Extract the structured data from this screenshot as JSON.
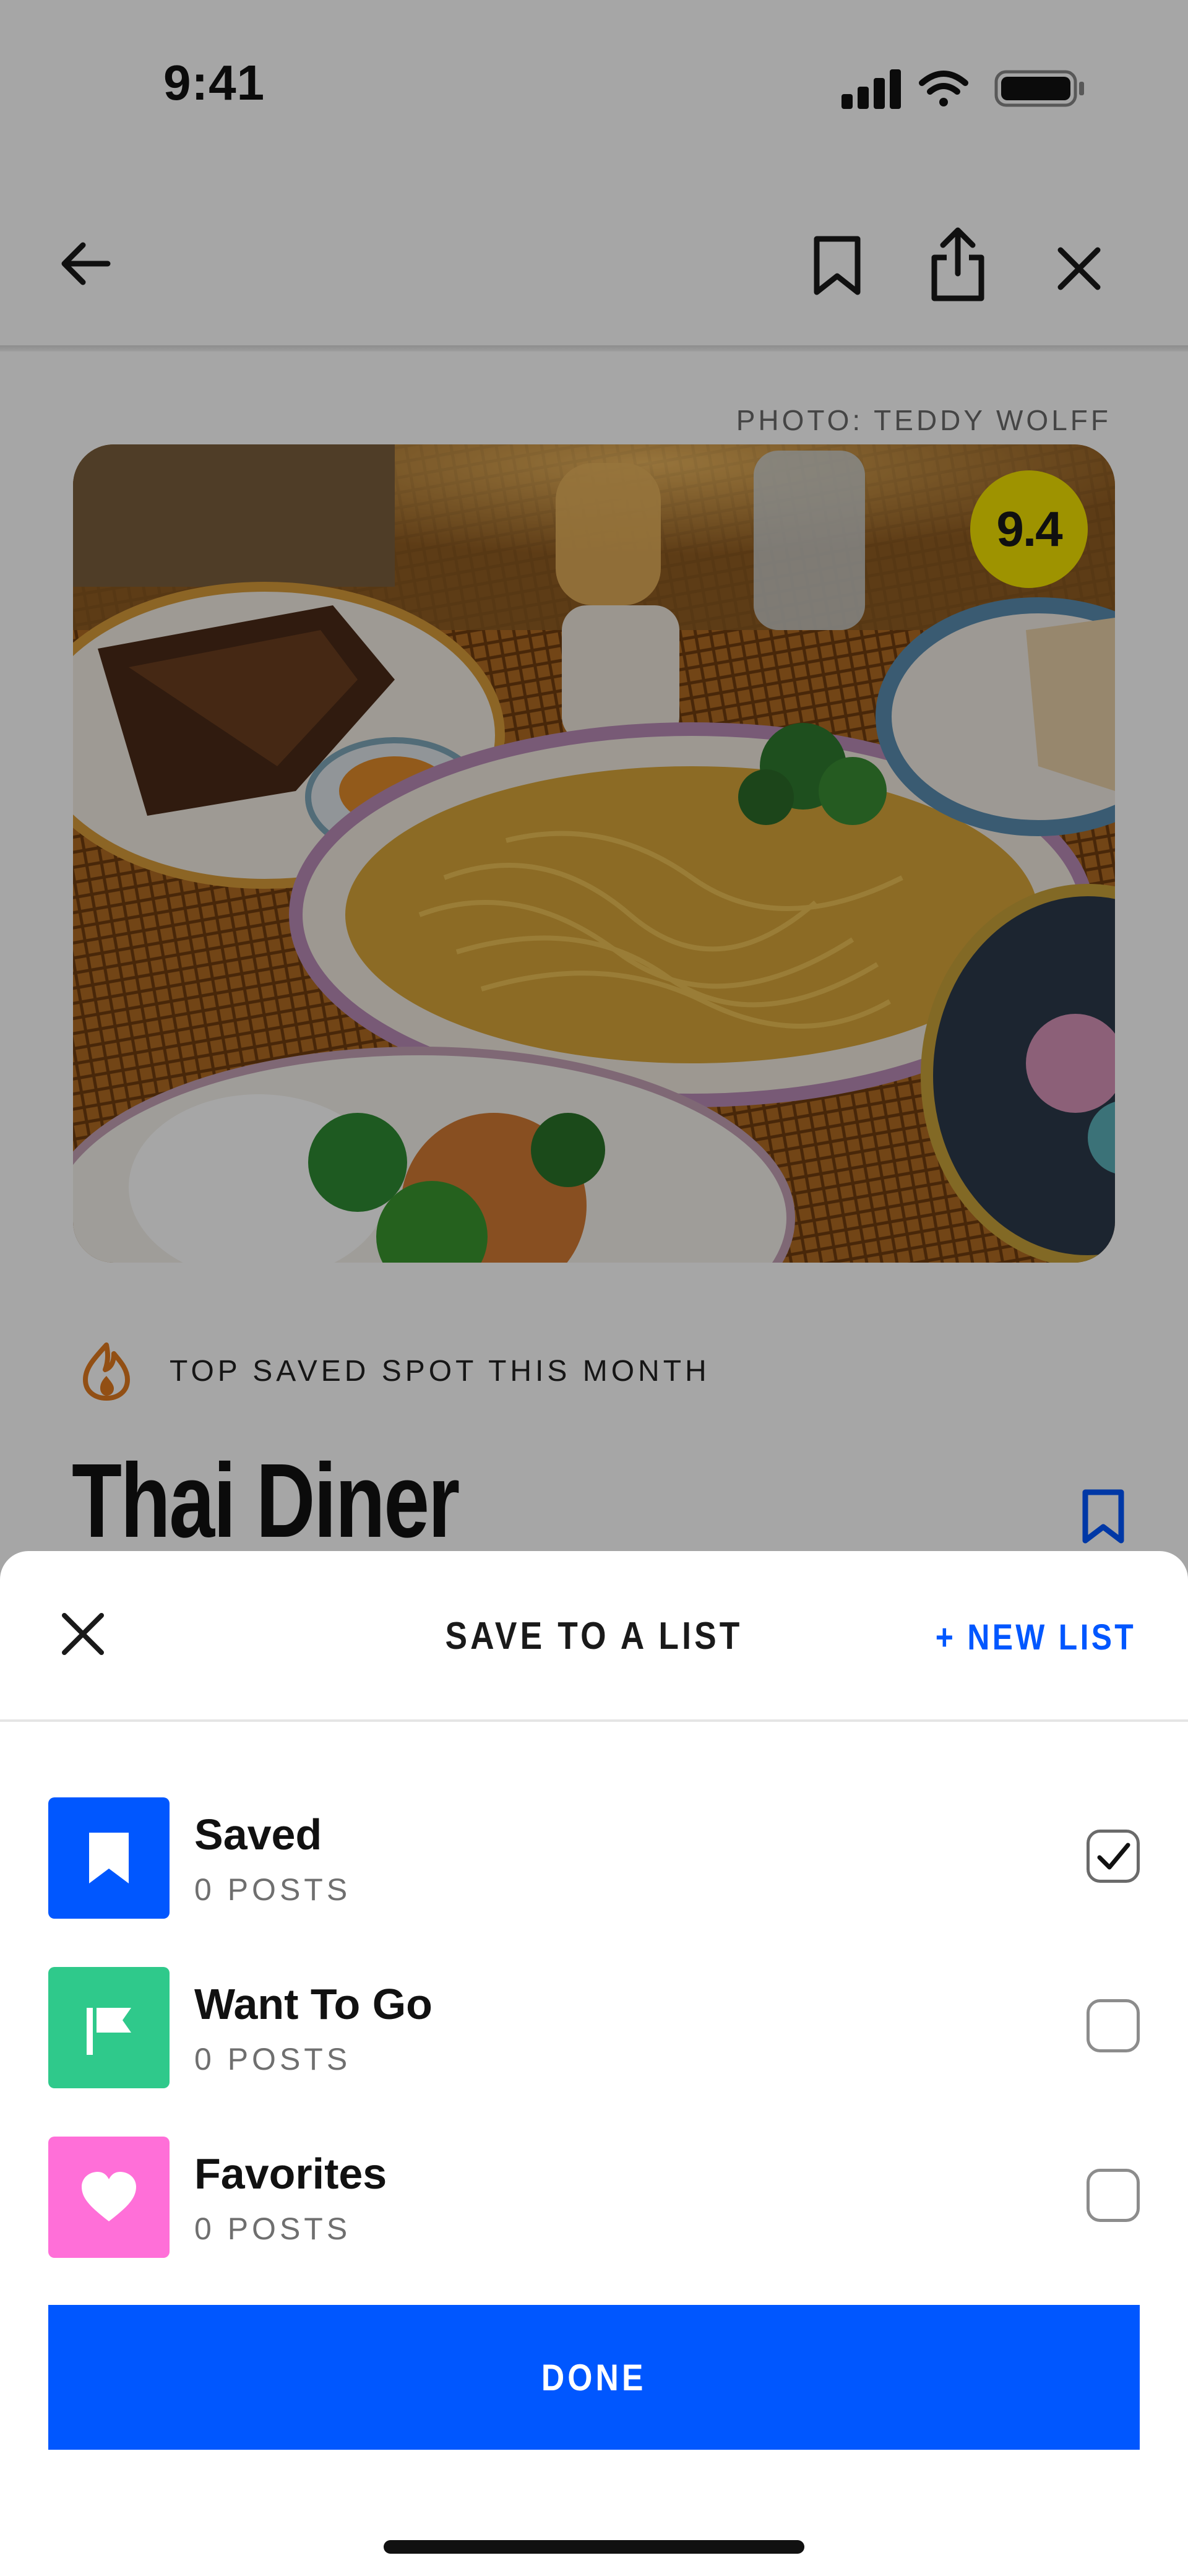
{
  "status_bar": {
    "time": "9:41",
    "icons": [
      "cellular-signal-icon",
      "wifi-icon",
      "battery-icon"
    ]
  },
  "nav": {
    "icons": [
      "back-arrow-icon",
      "bookmark-icon",
      "share-icon",
      "close-icon"
    ]
  },
  "venue": {
    "photo_credit": "PHOTO: TEDDY WOLFF",
    "score": "9.4",
    "badge_icon": "flame-icon",
    "badge_text": "TOP SAVED SPOT THIS MONTH",
    "name": "Thai Diner"
  },
  "sheet": {
    "title": "SAVE TO A LIST",
    "new_list": "+ NEW LIST",
    "lists": [
      {
        "name": "Saved",
        "count": "0 POSTS",
        "icon": "bookmark-icon",
        "color": "#0057ff",
        "checked": true
      },
      {
        "name": "Want To Go",
        "count": "0 POSTS",
        "icon": "flag-icon",
        "color": "#2fc98b",
        "checked": false
      },
      {
        "name": "Favorites",
        "count": "0 POSTS",
        "icon": "heart-icon",
        "color": "#ff6fd8",
        "checked": false
      }
    ],
    "done": "DONE"
  },
  "colors": {
    "accent": "#0057ff",
    "score_badge": "#f3e200",
    "flame": "#e07a1f"
  }
}
